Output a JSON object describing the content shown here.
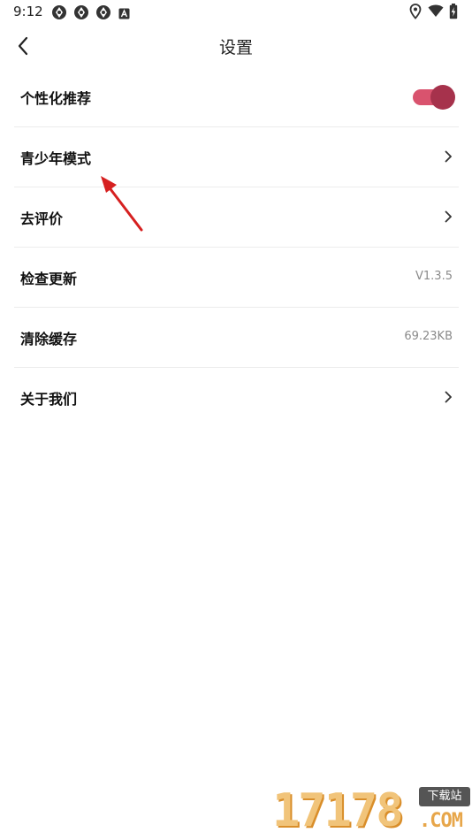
{
  "status_bar": {
    "time": "9:12",
    "app_icons": [
      "app-notification-icon",
      "app-notification-icon",
      "app-notification-icon",
      "accessibility-notification-icon"
    ],
    "right_icons": [
      "location-icon",
      "wifi-icon",
      "battery-charging-icon"
    ]
  },
  "header": {
    "title": "设置",
    "back_icon": "back-arrow-icon"
  },
  "settings": {
    "items": [
      {
        "label": "个性化推荐",
        "control": "toggle",
        "toggle_on": true
      },
      {
        "label": "青少年模式",
        "control": "chevron"
      },
      {
        "label": "去评价",
        "control": "chevron"
      },
      {
        "label": "检查更新",
        "control": "value",
        "value": "V1.3.5"
      },
      {
        "label": "清除缓存",
        "control": "value",
        "value": "69.23KB"
      },
      {
        "label": "关于我们",
        "control": "chevron"
      }
    ]
  },
  "colors": {
    "toggle_track": "#d9536e",
    "toggle_thumb": "#a6324c",
    "annotation_arrow": "#d62020",
    "divider": "#ececec",
    "secondary_text": "#8a8a8a"
  },
  "watermark": {
    "number": "17178",
    "tag": "下载站",
    "domain": ".COM"
  }
}
